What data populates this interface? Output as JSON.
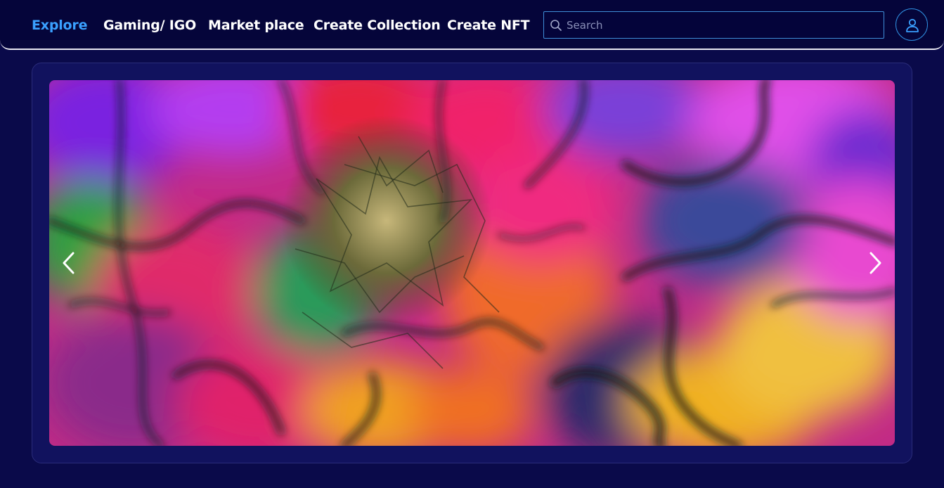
{
  "nav": {
    "items": [
      {
        "label": "Explore",
        "active": true
      },
      {
        "label": "Gaming/ IGO",
        "active": false
      },
      {
        "label": "Market place",
        "active": false
      },
      {
        "label": "Create Collection",
        "active": false
      },
      {
        "label": "Create NFT",
        "active": false
      }
    ]
  },
  "search": {
    "placeholder": "Search",
    "value": "",
    "icon": "search-icon"
  },
  "user": {
    "icon": "user-icon"
  },
  "carousel": {
    "image_description": "abstract-fractal-art",
    "prev_icon": "chevron-left-icon",
    "next_icon": "chevron-right-icon"
  },
  "colors": {
    "background": "#0a0a4a",
    "topbar": "#05053a",
    "accent": "#3aa0ff",
    "card": "#11125e"
  }
}
